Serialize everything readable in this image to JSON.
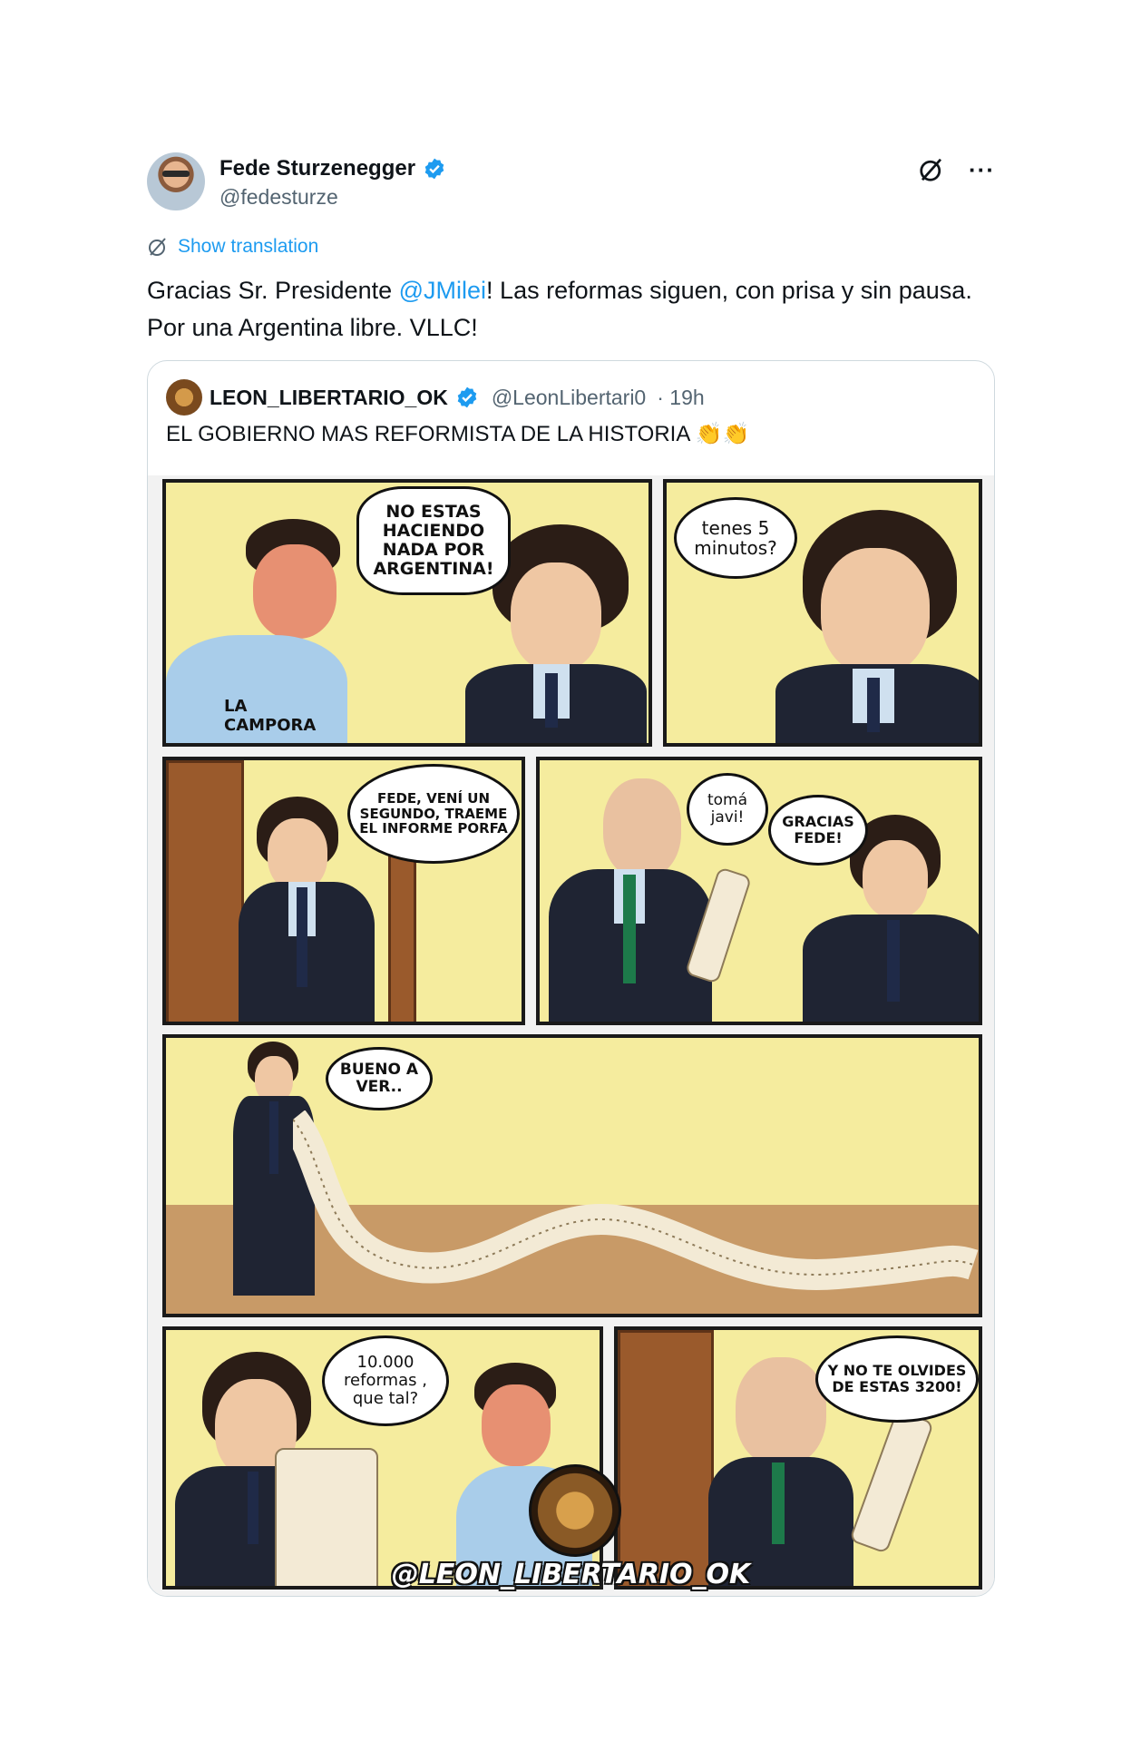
{
  "author": {
    "name": "Fede Sturzenegger",
    "handle": "@fedesturze"
  },
  "translation_label": "Show translation",
  "body": {
    "part1": "Gracias Sr. Presidente ",
    "mention": "@JMilei",
    "part2": "! Las reformas siguen, con prisa y sin pausa. Por una Argentina libre. VLLC!"
  },
  "quote": {
    "name": "LEON_LIBERTARIO_OK",
    "handle": "@LeonLibertari0",
    "time": "· 19h",
    "text": "EL GOBIERNO MAS REFORMISTA DE LA HISTORIA 👏👏"
  },
  "comic": {
    "p1_bubble": "NO ESTAS HACIENDO NADA POR ARGENTINA!",
    "p1_shirt": "LA CAMPORA",
    "p2_bubble": "tenes 5 minutos?",
    "p3_bubble": "FEDE, VENÍ UN SEGUNDO, TRAEME EL INFORME PORFA",
    "p4_bubble_a": "tomá javi!",
    "p4_bubble_b": "GRACIAS FEDE!",
    "p5_bubble": "BUENO A VER..",
    "p6_bubble": "10.000 reformas , que tal?",
    "p7_bubble": "Y NO TE OLVIDES DE ESTAS 3200!",
    "watermark": "@LEON_LIBERTARIO_OK"
  },
  "icons": {
    "verified": "verified-badge-icon",
    "grok": "grok-icon",
    "more": "more-icon",
    "translate": "translate-icon"
  },
  "colors": {
    "accent": "#1d9bf0",
    "muted": "#536471",
    "panel_bg": "#f5ec9e"
  }
}
